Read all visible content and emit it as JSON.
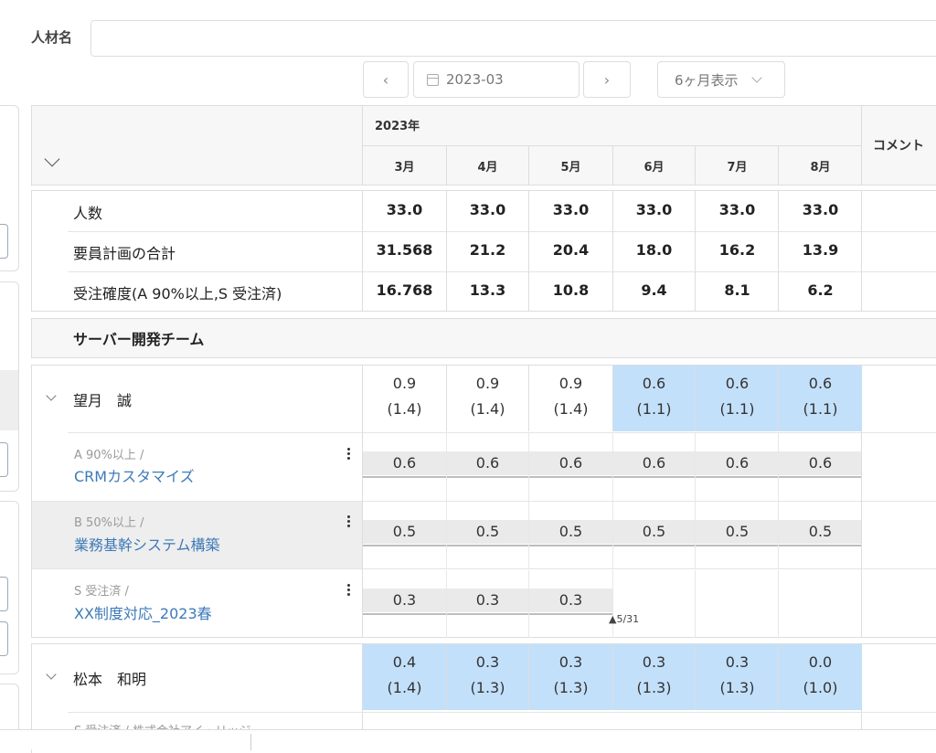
{
  "filter": {
    "label": "人材名",
    "value": ""
  },
  "date_nav": {
    "prev_icon": "‹",
    "next_icon": "›",
    "date_value": "2023-03",
    "period_select": "6ヶ月表示"
  },
  "header": {
    "year": "2023年",
    "months": [
      "3月",
      "4月",
      "5月",
      "6月",
      "7月",
      "8月"
    ],
    "comment": "コメント"
  },
  "summary": [
    {
      "label": "人数",
      "values": [
        "33.0",
        "33.0",
        "33.0",
        "33.0",
        "33.0",
        "33.0"
      ]
    },
    {
      "label": "要員計画の合計",
      "values": [
        "31.568",
        "21.2",
        "20.4",
        "18.0",
        "16.2",
        "13.9"
      ]
    },
    {
      "label": "受注確度(A 90%以上,S 受注済)",
      "values": [
        "16.768",
        "13.3",
        "10.8",
        "9.4",
        "8.1",
        "6.2"
      ]
    }
  ],
  "team": {
    "name": "サーバー開発チーム"
  },
  "people": [
    {
      "name": "望月　誠",
      "cells": [
        {
          "v": "0.9",
          "sub": "(1.4)",
          "highlight": false
        },
        {
          "v": "0.9",
          "sub": "(1.4)",
          "highlight": false
        },
        {
          "v": "0.9",
          "sub": "(1.4)",
          "highlight": false
        },
        {
          "v": "0.6",
          "sub": "(1.1)",
          "highlight": true
        },
        {
          "v": "0.6",
          "sub": "(1.1)",
          "highlight": true
        },
        {
          "v": "0.6",
          "sub": "(1.1)",
          "highlight": true
        }
      ],
      "projects": [
        {
          "type": "A 90%以上 /",
          "name": "CRMカスタマイズ",
          "values": [
            "0.6",
            "0.6",
            "0.6",
            "0.6",
            "0.6",
            "0.6"
          ]
        },
        {
          "type": "B 50%以上 /",
          "name": "業務基幹システム構築",
          "values": [
            "0.5",
            "0.5",
            "0.5",
            "0.5",
            "0.5",
            "0.5"
          ]
        },
        {
          "type": "S 受注済 /",
          "name": "XX制度対応_2023春",
          "values": [
            "0.3",
            "0.3",
            "0.3"
          ],
          "end_marker": "▲5/31"
        }
      ]
    },
    {
      "name": "松本　和明",
      "cells": [
        {
          "v": "0.4",
          "sub": "(1.4)",
          "highlight": true
        },
        {
          "v": "0.3",
          "sub": "(1.3)",
          "highlight": true
        },
        {
          "v": "0.3",
          "sub": "(1.3)",
          "highlight": true
        },
        {
          "v": "0.3",
          "sub": "(1.3)",
          "highlight": true
        },
        {
          "v": "0.3",
          "sub": "(1.3)",
          "highlight": true
        },
        {
          "v": "0.0",
          "sub": "(1.0)",
          "highlight": true
        }
      ],
      "projects_partial": "S 受注済 / 株式会社アイ・リッジ"
    }
  ]
}
